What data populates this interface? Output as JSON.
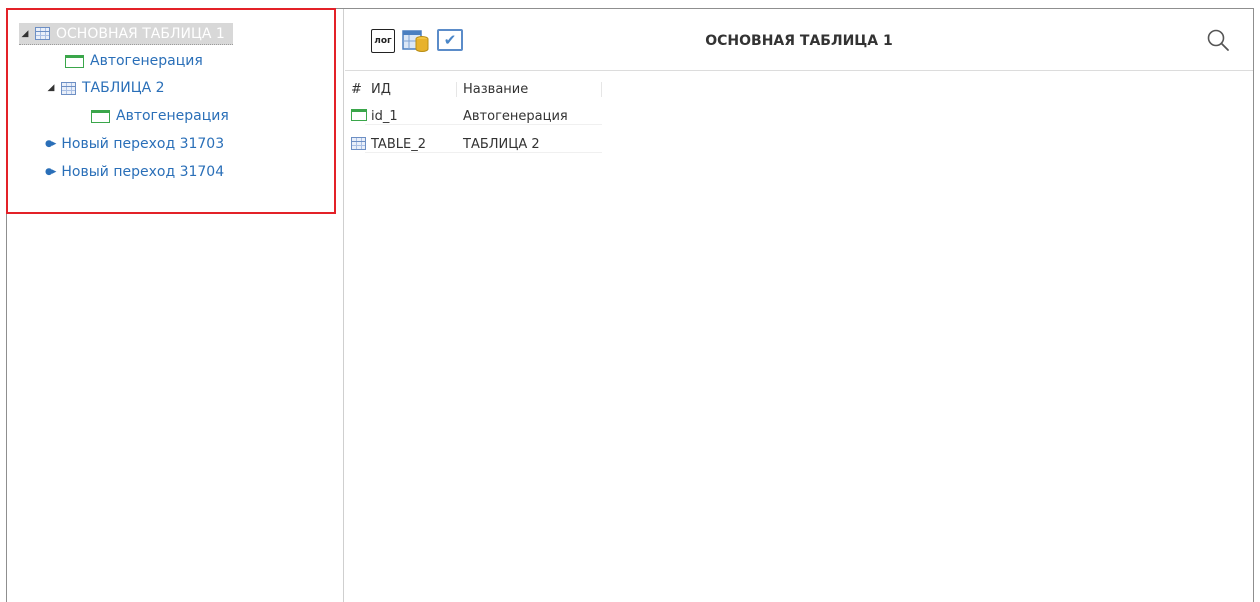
{
  "tree": {
    "root_label": "ОСНОВНАЯ ТАБЛИЦА 1",
    "child_auto_label": "Автогенерация",
    "table2_label": "ТАБЛИЦА 2",
    "table2_auto_label": "Автогенерация",
    "transition1_label": "Новый переход 31703",
    "transition2_label": "Новый переход 31704"
  },
  "toolbar": {
    "log_label": "лог",
    "title": "ОСНОВНАЯ ТАБЛИЦА 1"
  },
  "grid": {
    "columns": [
      "#",
      "ИД",
      "Название"
    ],
    "rows": [
      {
        "icon": "autogen-icon",
        "id": "id_1",
        "name": "Автогенерация"
      },
      {
        "icon": "table-icon",
        "id": "TABLE_2",
        "name": "ТАБЛИЦА 2"
      }
    ]
  },
  "colors": {
    "link": "#2a6fb8",
    "highlight_border": "#e32128",
    "autogen_icon": "#3aa64a",
    "table_icon": "#6d8fc4"
  }
}
